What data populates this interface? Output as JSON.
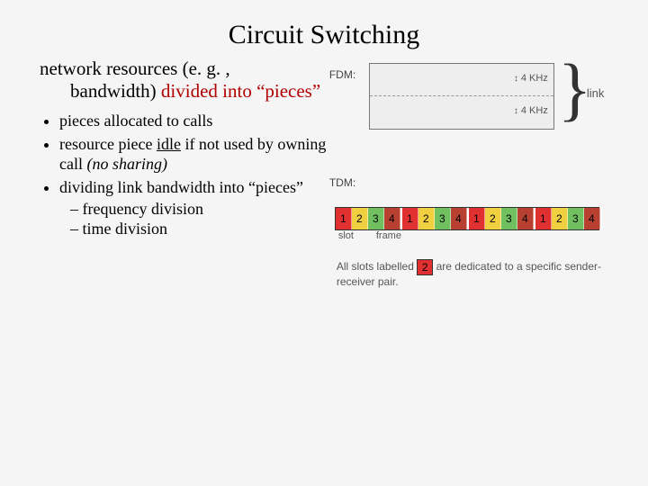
{
  "title": "Circuit Switching",
  "intro": {
    "line1": "network resources (e. g. ,",
    "line2a": "bandwidth) ",
    "line2b_red": "divided into “pieces”"
  },
  "bullets": {
    "b1": "pieces allocated to calls",
    "b2a": "resource piece ",
    "b2_idle": "idle",
    "b2b": " if not used by owning call ",
    "b2_no_sharing": "(no sharing)",
    "b3": "dividing link bandwidth into “pieces”",
    "sub1": "frequency division",
    "sub2": "time division"
  },
  "fdm": {
    "label": "FDM:",
    "khz1": "4 KHz",
    "khz2": "4 KHz",
    "link": "link"
  },
  "tdm": {
    "label": "TDM:",
    "slots": [
      "1",
      "2",
      "3",
      "4"
    ],
    "slot_label": "slot",
    "frame_label": "frame",
    "caption_a": "All slots labelled ",
    "caption_slot": "2",
    "caption_b": " are dedicated to a specific sender-receiver pair."
  }
}
